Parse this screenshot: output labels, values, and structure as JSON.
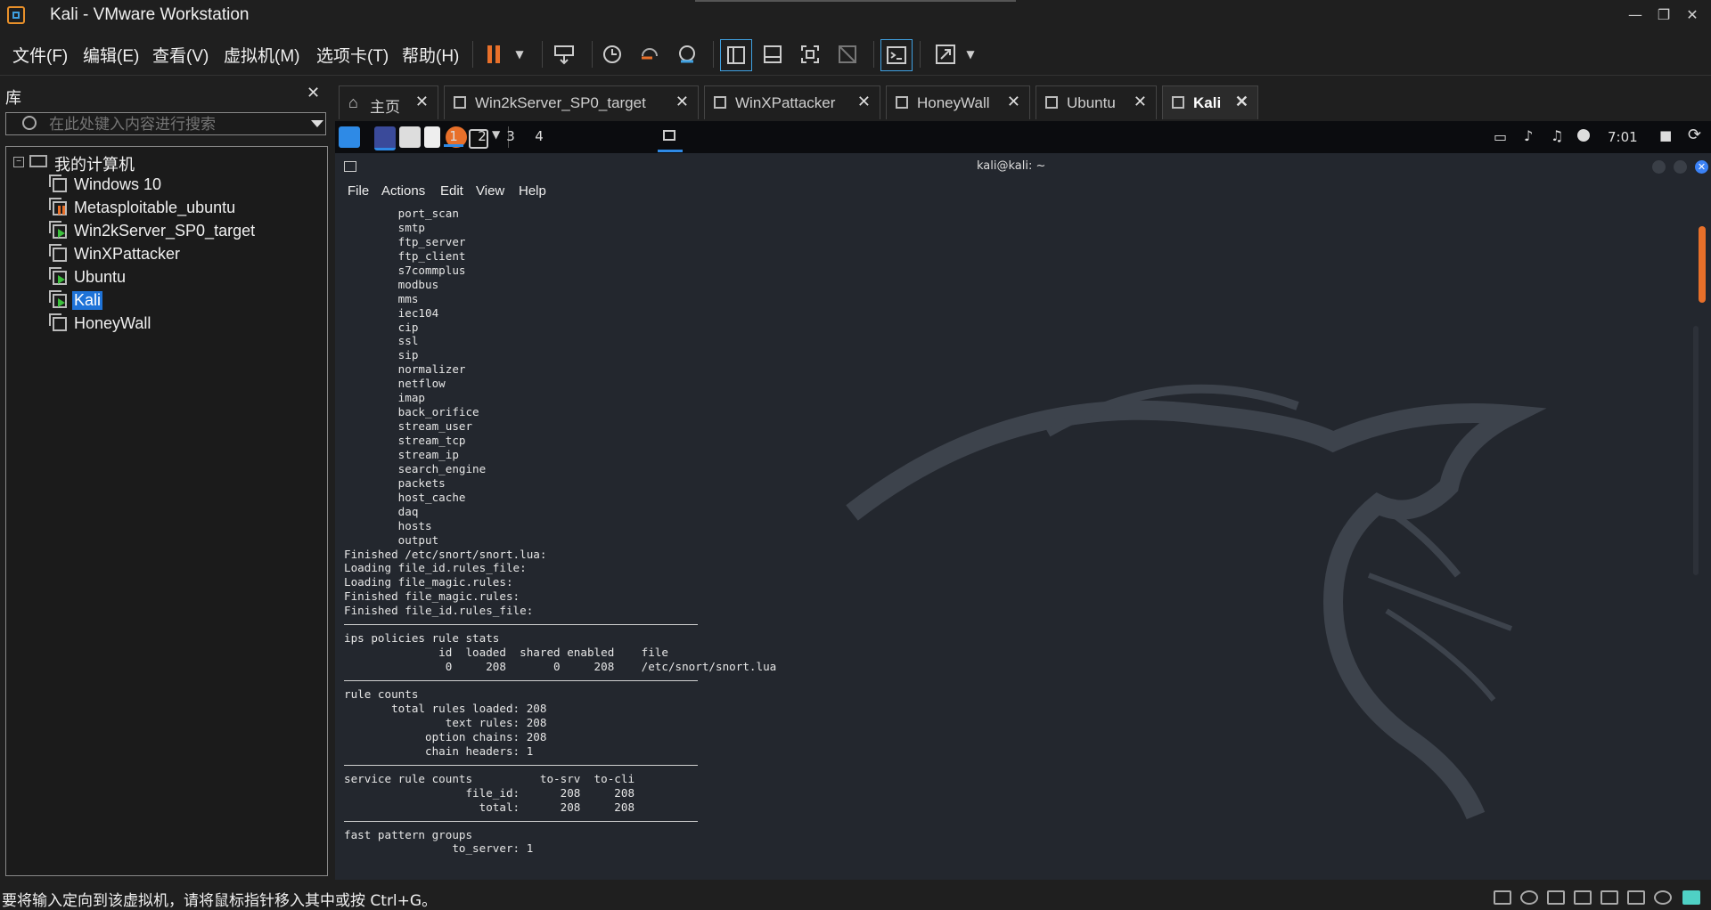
{
  "window": {
    "title": "Kali - VMware Workstation",
    "controls": {
      "minimize": "—",
      "restore": "❐",
      "close": "✕"
    }
  },
  "menubar": {
    "items": [
      "文件(F)",
      "编辑(E)",
      "查看(V)",
      "虚拟机(M)",
      "选项卡(T)",
      "帮助(H)"
    ]
  },
  "toolbar": {
    "icons": [
      "pause-icon",
      "dropdown-icon",
      "send-ctrl-alt-del-icon",
      "snapshot-icon",
      "revert-snapshot-icon",
      "snapshot-manager-icon",
      "library-view-icon",
      "thumbnail-view-icon",
      "fullscreen-icon",
      "unity-icon",
      "console-view-icon",
      "stretch-icon"
    ]
  },
  "library": {
    "title": "库",
    "close": "✕",
    "search_placeholder": "在此处键入内容进行搜索",
    "root": "我的计算机",
    "vms": [
      {
        "name": "Windows 10",
        "state": "off"
      },
      {
        "name": "Metasploitable_ubuntu",
        "state": "paused"
      },
      {
        "name": "Win2kServer_SP0_target",
        "state": "running"
      },
      {
        "name": "WinXPattacker",
        "state": "off"
      },
      {
        "name": "Ubuntu",
        "state": "running"
      },
      {
        "name": "Kali",
        "state": "running",
        "selected": true
      },
      {
        "name": "HoneyWall",
        "state": "off"
      }
    ]
  },
  "tabs": [
    {
      "label": "主页",
      "close": "✕"
    },
    {
      "label": "Win2kServer_SP0_target",
      "close": "✕"
    },
    {
      "label": "WinXPattacker",
      "close": "✕"
    },
    {
      "label": "HoneyWall",
      "close": "✕"
    },
    {
      "label": "Ubuntu",
      "close": "✕"
    },
    {
      "label": "Kali",
      "close": "✕",
      "active": true
    }
  ],
  "kali_panel": {
    "workspaces": [
      "1",
      "2",
      "3",
      "4"
    ],
    "clock": "7:01"
  },
  "terminal": {
    "title": "kali@kali: ~",
    "menu": [
      "File",
      "Actions",
      "Edit",
      "View",
      "Help"
    ],
    "lines": [
      "        port_scan",
      "        smtp",
      "        ftp_server",
      "        ftp_client",
      "        s7commplus",
      "        modbus",
      "        mms",
      "        iec104",
      "        cip",
      "        ssl",
      "        sip",
      "        normalizer",
      "        netflow",
      "        imap",
      "        back_orifice",
      "        stream_user",
      "        stream_tcp",
      "        stream_ip",
      "        search_engine",
      "        packets",
      "        host_cache",
      "        daq",
      "        hosts",
      "        output",
      "Finished /etc/snort/snort.lua:",
      "Loading file_id.rules_file:",
      "Loading file_magic.rules:",
      "Finished file_magic.rules:",
      "Finished file_id.rules_file:",
      "---",
      "ips policies rule stats",
      "              id  loaded  shared enabled    file",
      "               0     208       0     208    /etc/snort/snort.lua",
      "---",
      "rule counts",
      "       total rules loaded: 208",
      "               text rules: 208",
      "            option chains: 208",
      "            chain headers: 1",
      "---",
      "service rule counts          to-srv  to-cli",
      "                  file_id:      208     208",
      "                    total:      208     208",
      "---",
      "fast pattern groups",
      "                to_server: 1"
    ]
  },
  "statusbar": {
    "message": "要将输入定向到该虚拟机，请将鼠标指针移入其中或按 Ctrl+G。"
  }
}
